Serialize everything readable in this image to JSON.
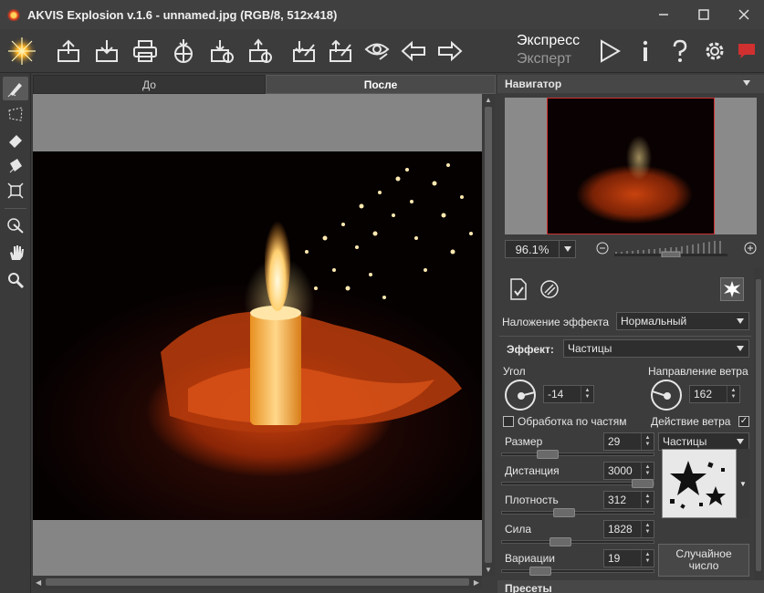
{
  "window": {
    "title": "AKVIS Explosion v.1.6 - unnamed.jpg (RGB/8, 512x418)"
  },
  "toolbar": {
    "mode_express": "Экспресс",
    "mode_expert": "Эксперт"
  },
  "tabs": {
    "before": "До",
    "after": "После"
  },
  "navigator": {
    "title": "Навигатор",
    "zoom": "96.1%"
  },
  "settings": {
    "blend_label": "Наложение эффекта",
    "blend_value": "Нормальный",
    "effect_label": "Эффект:",
    "effect_value": "Частицы",
    "angle_label": "Угол",
    "angle_value": "-14",
    "wind_label": "Направление ветра",
    "wind_value": "162",
    "partial_label": "Обработка по частям",
    "wind_action_label": "Действие ветра",
    "size_label": "Размер",
    "size_value": "29",
    "particles_type": "Частицы",
    "distance_label": "Дистанция",
    "distance_value": "3000",
    "density_label": "Плотность",
    "density_value": "312",
    "force_label": "Сила",
    "force_value": "1828",
    "variation_label": "Вариации",
    "variation_value": "19",
    "random_button": "Случайное число"
  },
  "presets": {
    "title": "Пресеты"
  },
  "colors": {
    "accent_red": "#d03030",
    "panel_bg": "#3c3c3c",
    "canvas_gray": "#858585"
  }
}
